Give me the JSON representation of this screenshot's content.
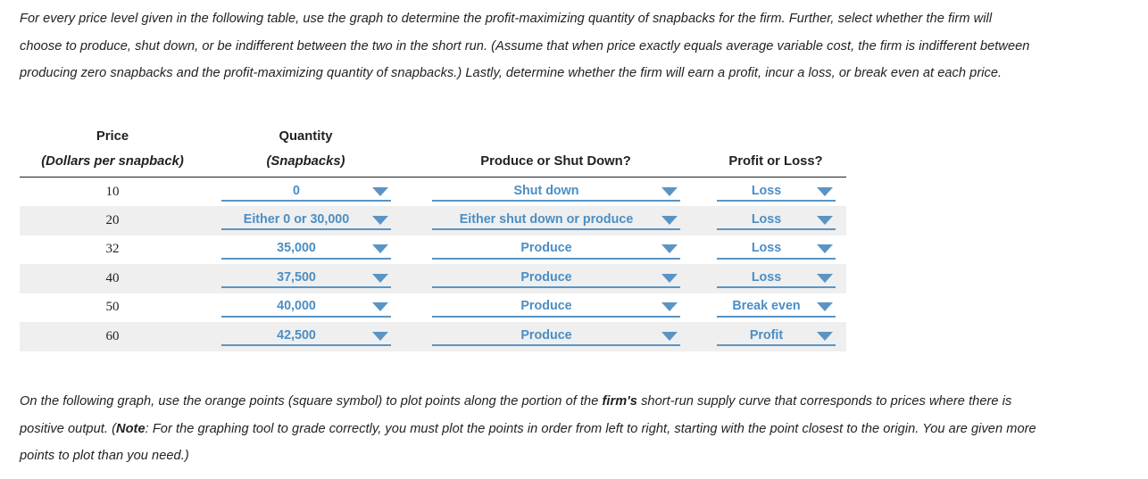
{
  "intro_paragraph": {
    "line1": "For every price level given in the following table, use the graph to determine the profit-maximizing quantity of snapbacks for the firm. Further, select",
    "line2": "whether the firm will choose to produce, shut down, or be indifferent between the two in the short run. (Assume that when price exactly equals",
    "line3": "average variable cost, the firm is indifferent between producing zero snapbacks and the profit-maximizing quantity of snapbacks.) Lastly, determine",
    "line4": "whether the firm will earn a profit, incur a loss, or break even at each price.",
    "full": "For every price level given in the following table, use the graph to determine the profit-maximizing quantity of snapbacks for the firm. Further, select whether the firm will choose to produce, shut down, or be indifferent between the two in the short run. (Assume that when price exactly equals average variable cost, the firm is indifferent between producing zero snapbacks and the profit-maximizing quantity of snapbacks.) Lastly, determine whether the firm will earn a profit, incur a loss, or break even at each price."
  },
  "table": {
    "headers": {
      "price_main": "Price",
      "price_sub": "(Dollars per snapback)",
      "quantity_main": "Quantity",
      "quantity_sub": "(Snapbacks)",
      "produce_or_shut_down": "Produce or Shut Down?",
      "profit_or_loss": "Profit or Loss?"
    },
    "rows": [
      {
        "price": "10",
        "quantity": "0",
        "produce_or_shut_down": "Shut down",
        "profit_or_loss": "Loss"
      },
      {
        "price": "20",
        "quantity": "Either 0 or 30,000",
        "produce_or_shut_down": "Either shut down or produce",
        "profit_or_loss": "Loss"
      },
      {
        "price": "32",
        "quantity": "35,000",
        "produce_or_shut_down": "Produce",
        "profit_or_loss": "Loss"
      },
      {
        "price": "40",
        "quantity": "37,500",
        "produce_or_shut_down": "Produce",
        "profit_or_loss": "Loss"
      },
      {
        "price": "50",
        "quantity": "40,000",
        "produce_or_shut_down": "Produce",
        "profit_or_loss": "Break even"
      },
      {
        "price": "60",
        "quantity": "42,500",
        "produce_or_shut_down": "Produce",
        "profit_or_loss": "Profit"
      }
    ]
  },
  "outro_paragraph": {
    "part1": "On the following graph, use the orange points (square symbol) to plot points along the portion of the ",
    "bold1": "firm's",
    "part2": " short-run supply curve that corresponds to prices where there is positive output. (",
    "bold2": "Note",
    "part3": ": For the graphing tool to grade correctly, you must plot the points in order from left to right, starting with the point closest to the origin. You are given more points to plot than you need.)"
  },
  "colors": {
    "dropdown_blue": "#4b8ec4",
    "dropdown_underline": "#5b94c4",
    "text_black": "#231f20",
    "row_stripe": "#efefef"
  }
}
